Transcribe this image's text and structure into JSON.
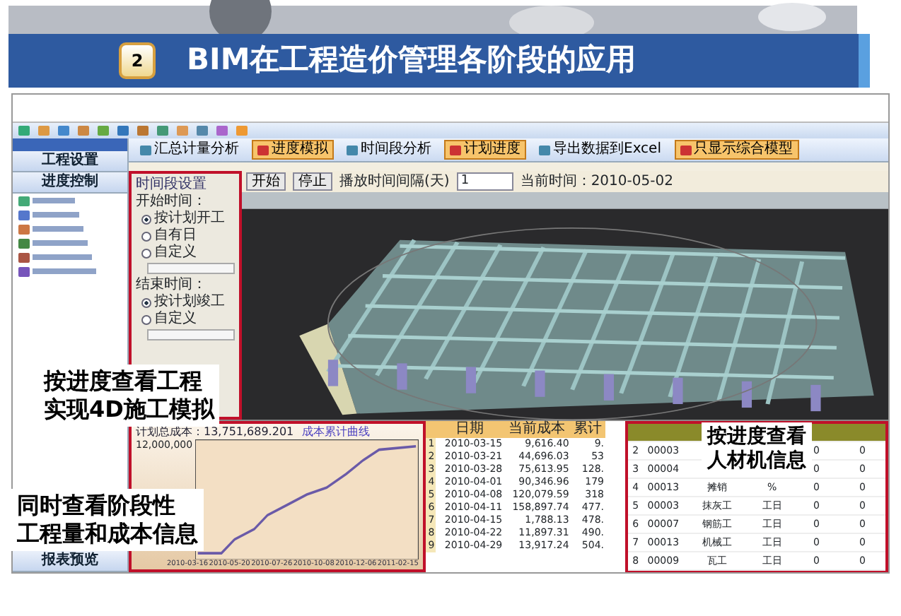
{
  "slide": {
    "number": "2",
    "title": "BIM在工程造价管理各阶段的应用"
  },
  "toolbar": [
    {
      "label": "汇总计量分析",
      "selected": false
    },
    {
      "label": "进度模拟",
      "selected": true
    },
    {
      "label": "时间段分析",
      "selected": false
    },
    {
      "label": "计划进度",
      "selected": true
    },
    {
      "label": "导出数据到Excel",
      "selected": false
    },
    {
      "label": "只显示综合模型",
      "selected": true
    }
  ],
  "sidebar": {
    "sections": [
      "工程设置",
      "进度控制"
    ],
    "footer": "报表预览"
  },
  "settings": {
    "title": "时间段设置",
    "groups": [
      {
        "label": "开始时间：",
        "options": [
          {
            "label": "按计划开工",
            "selected": true
          },
          {
            "label": "自有日",
            "selected": false
          },
          {
            "label": "自定义",
            "selected": false
          }
        ]
      },
      {
        "label": "结束时间：",
        "options": [
          {
            "label": "按计划竣工",
            "selected": true
          },
          {
            "label": "自定义",
            "selected": false
          }
        ]
      }
    ]
  },
  "viewer": {
    "buttons": [
      "开始",
      "停止"
    ],
    "interval_label": "播放时间间隔(天)",
    "interval_value": "1",
    "current_time": "当前时间：2010-05-02"
  },
  "chart": {
    "total": "计划总成本：13,751,689.201",
    "title": "成本累计曲线",
    "y_tick": "12,000,000",
    "x_labels": [
      "2010-03-16",
      "2010-05-20",
      "2010-07-26",
      "2010-10-08",
      "2010-12-06",
      "2011-02-15"
    ]
  },
  "cost_table": {
    "columns": [
      "日期",
      "当前成本",
      "累计"
    ],
    "rows": [
      {
        "no": "1",
        "cells": [
          "2010-03-15",
          "9,616.40",
          "9."
        ]
      },
      {
        "no": "2",
        "cells": [
          "2010-03-21",
          "44,696.03",
          "53"
        ]
      },
      {
        "no": "3",
        "cells": [
          "2010-03-28",
          "75,613.95",
          "128."
        ]
      },
      {
        "no": "4",
        "cells": [
          "2010-04-01",
          "90,346.96",
          "179"
        ]
      },
      {
        "no": "5",
        "cells": [
          "2010-04-08",
          "120,079.59",
          "318"
        ]
      },
      {
        "no": "6",
        "cells": [
          "2010-04-11",
          "158,897.74",
          "477."
        ]
      },
      {
        "no": "7",
        "cells": [
          "2010-04-15",
          "1,788.13",
          "478."
        ]
      },
      {
        "no": "8",
        "cells": [
          "2010-04-22",
          "11,897.31",
          "490."
        ]
      },
      {
        "no": "9",
        "cells": [
          "2010-04-29",
          "13,917.24",
          "504."
        ]
      }
    ]
  },
  "resource_table": {
    "rows": [
      [
        "2",
        "00003",
        "",
        "",
        "0",
        "0"
      ],
      [
        "3",
        "00004",
        "",
        "",
        "0",
        "0"
      ],
      [
        "4",
        "00013",
        "摊销",
        "%",
        "0",
        "0"
      ],
      [
        "5",
        "00003",
        "抹灰工",
        "工日",
        "0",
        "0"
      ],
      [
        "6",
        "00007",
        "钢筋工",
        "工日",
        "0",
        "0"
      ],
      [
        "7",
        "00013",
        "机械工",
        "工日",
        "0",
        "0"
      ],
      [
        "8",
        "00009",
        "瓦工",
        "工日",
        "0",
        "0"
      ]
    ]
  },
  "callouts": [
    {
      "lines": [
        "按进度查看工程",
        "实现4D施工模拟"
      ]
    },
    {
      "lines": [
        "同时查看阶段性",
        "工程量和成本信息"
      ]
    },
    {
      "lines": [
        "按进度查看",
        "人材机信息"
      ]
    }
  ]
}
